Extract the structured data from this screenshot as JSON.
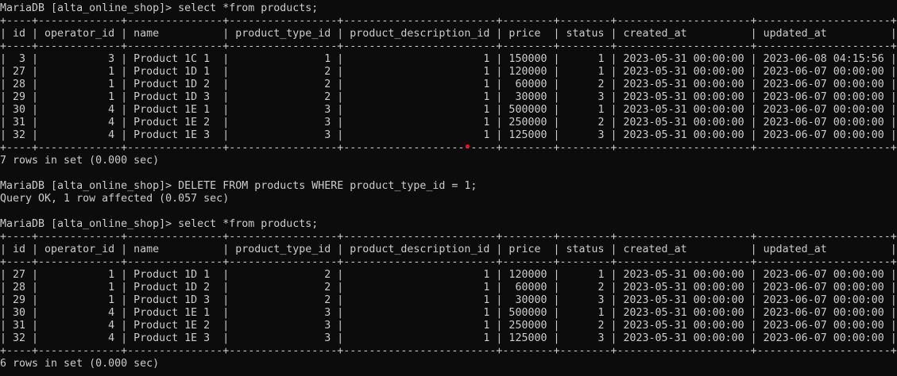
{
  "terminal": {
    "lines": [
      "MariaDB [alta_online_shop]> select *from products;",
      "+----+-------------+---------------+-----------------+------------------------+--------+--------+---------------------+---------------------+",
      "| id | operator_id | name          | product_type_id | product_description_id | price  | status | created_at          | updated_at          |",
      "+----+-------------+---------------+-----------------+------------------------+--------+--------+---------------------+---------------------+",
      "|  3 |           3 | Product 1C 1  |               1 |                      1 | 150000 |      1 | 2023-05-31 00:00:00 | 2023-06-08 04:15:56 |",
      "| 27 |           1 | Product 1D 1  |               2 |                      1 | 120000 |      1 | 2023-05-31 00:00:00 | 2023-06-07 00:00:00 |",
      "| 28 |           1 | Product 1D 2  |               2 |                      1 |  60000 |      2 | 2023-05-31 00:00:00 | 2023-06-07 00:00:00 |",
      "| 29 |           1 | Product 1D 3  |               2 |                      1 |  30000 |      3 | 2023-05-31 00:00:00 | 2023-06-07 00:00:00 |",
      "| 30 |           4 | Product 1E 1  |               3 |                      1 | 500000 |      1 | 2023-05-31 00:00:00 | 2023-06-07 00:00:00 |",
      "| 31 |           4 | Product 1E 2  |               3 |                      1 | 250000 |      2 | 2023-05-31 00:00:00 | 2023-06-07 00:00:00 |",
      "| 32 |           4 | Product 1E 3  |               3 |                      1 | 125000 |      3 | 2023-05-31 00:00:00 | 2023-06-07 00:00:00 |",
      "+----+-------------+---------------+-----------------+------------------------+--------+--------+---------------------+---------------------+",
      "7 rows in set (0.000 sec)",
      "",
      "MariaDB [alta_online_shop]> DELETE FROM products WHERE product_type_id = 1;",
      "Query OK, 1 row affected (0.057 sec)",
      "",
      "MariaDB [alta_online_shop]> select *from products;",
      "+----+-------------+---------------+-----------------+------------------------+--------+--------+---------------------+---------------------+",
      "| id | operator_id | name          | product_type_id | product_description_id | price  | status | created_at          | updated_at          |",
      "+----+-------------+---------------+-----------------+------------------------+--------+--------+---------------------+---------------------+",
      "| 27 |           1 | Product 1D 1  |               2 |                      1 | 120000 |      1 | 2023-05-31 00:00:00 | 2023-06-07 00:00:00 |",
      "| 28 |           1 | Product 1D 2  |               2 |                      1 |  60000 |      2 | 2023-05-31 00:00:00 | 2023-06-07 00:00:00 |",
      "| 29 |           1 | Product 1D 3  |               2 |                      1 |  30000 |      3 | 2023-05-31 00:00:00 | 2023-06-07 00:00:00 |",
      "| 30 |           4 | Product 1E 1  |               3 |                      1 | 500000 |      1 | 2023-05-31 00:00:00 | 2023-06-07 00:00:00 |",
      "| 31 |           4 | Product 1E 2  |               3 |                      1 | 250000 |      2 | 2023-05-31 00:00:00 | 2023-06-07 00:00:00 |",
      "| 32 |           4 | Product 1E 3  |               3 |                      1 | 125000 |      3 | 2023-05-31 00:00:00 | 2023-06-07 00:00:00 |",
      "+----+-------------+---------------+-----------------+------------------------+--------+--------+---------------------+---------------------+",
      "6 rows in set (0.000 sec)"
    ]
  },
  "colors": {
    "background": "#0c0c0c",
    "text": "#cccccc",
    "cursor_marker": "#e81123"
  }
}
